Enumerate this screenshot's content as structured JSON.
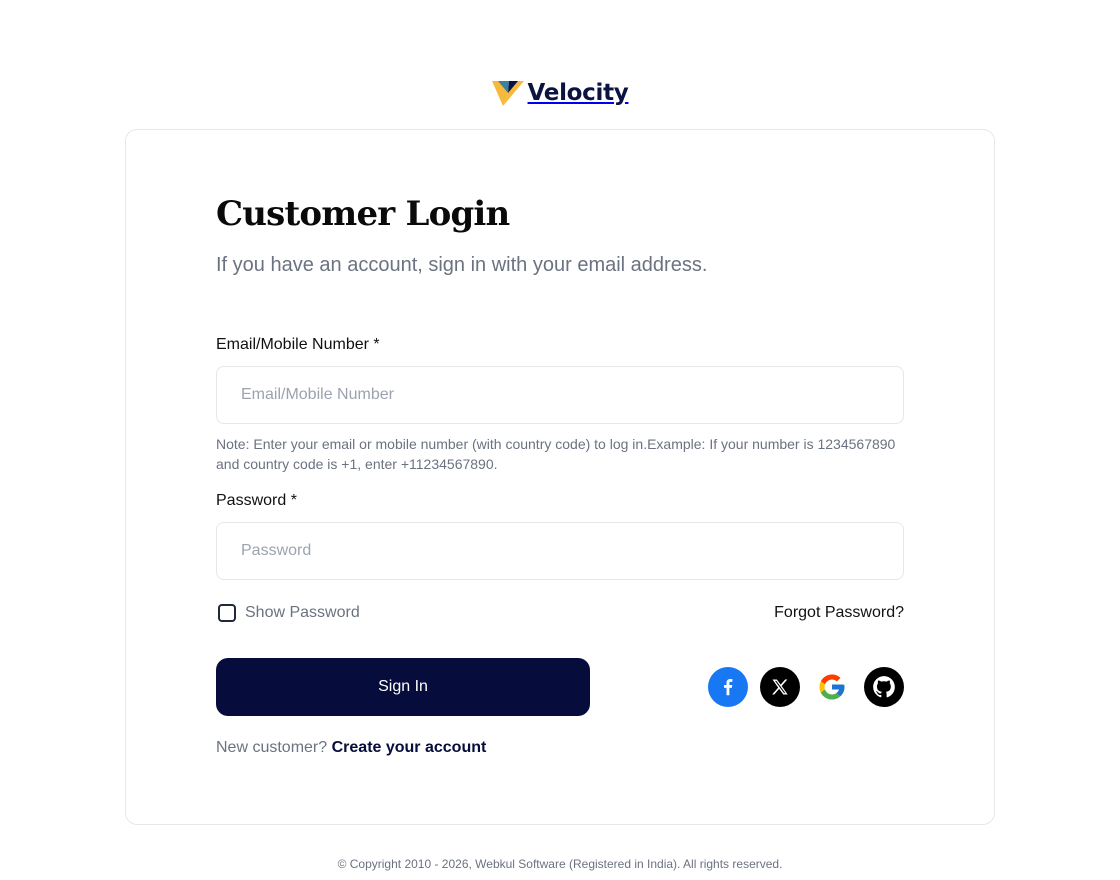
{
  "brand": {
    "name": "Velocity",
    "logo_icon": "velocity-v-logo",
    "colors": {
      "navy": "#060c3b",
      "gold": "#f6b93b",
      "teal": "#3b82a0"
    }
  },
  "login": {
    "title": "Customer Login",
    "subtitle": "If you have an account, sign in with your email address.",
    "email": {
      "label": "Email/Mobile Number *",
      "placeholder": "Email/Mobile Number",
      "value": "",
      "note": "Note: Enter your email or mobile number (with country code) to log in.Example: If your number is 1234567890 and country code is +1, enter +11234567890."
    },
    "password": {
      "label": "Password *",
      "placeholder": "Password",
      "value": ""
    },
    "show_password": {
      "label": "Show Password",
      "checked": false
    },
    "forgot_password": "Forgot Password?",
    "sign_in": "Sign In",
    "new_customer": {
      "text": "New customer?",
      "link": "Create your account"
    },
    "social": [
      {
        "name": "Facebook",
        "icon": "facebook-icon",
        "color": "#1877f2"
      },
      {
        "name": "X",
        "icon": "x-icon",
        "color": "#000000"
      },
      {
        "name": "Google",
        "icon": "google-icon",
        "color": "#ffffff"
      },
      {
        "name": "GitHub",
        "icon": "github-icon",
        "color": "#000000"
      }
    ]
  },
  "footer": {
    "copyright": "© Copyright 2010 - 2026, Webkul Software (Registered in India). All rights reserved."
  }
}
